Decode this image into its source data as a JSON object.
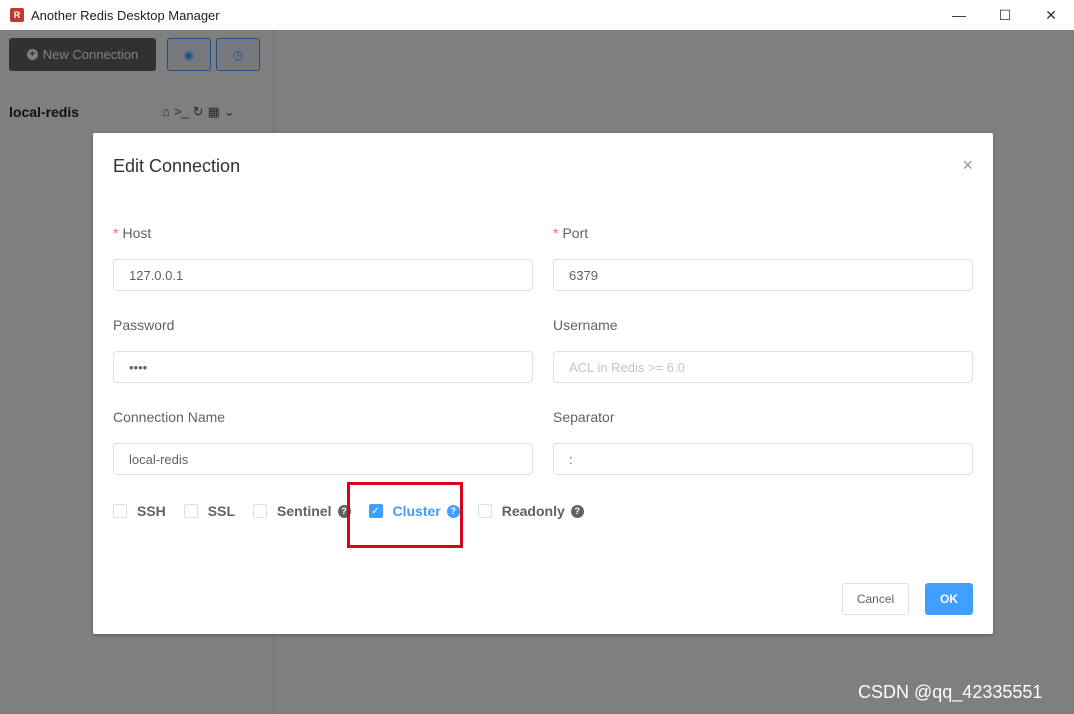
{
  "window": {
    "title": "Another Redis Desktop Manager",
    "icon": "app-logo-icon",
    "controls": {
      "minimize": "—",
      "maximize": "☐",
      "close": "✕"
    }
  },
  "sidebar": {
    "new_connection_label": "New Connection",
    "connection_name": "local-redis"
  },
  "dialog": {
    "title": "Edit Connection",
    "close_glyph": "×",
    "fields": {
      "host": {
        "label": "Host",
        "value": "127.0.0.1",
        "required": true
      },
      "port": {
        "label": "Port",
        "value": "6379",
        "required": true
      },
      "password": {
        "label": "Password",
        "value": "••••"
      },
      "username": {
        "label": "Username",
        "placeholder": "ACL in Redis >= 6.0"
      },
      "connection_name": {
        "label": "Connection Name",
        "value": "local-redis"
      },
      "separator": {
        "label": "Separator",
        "value": ":"
      }
    },
    "options": {
      "ssh": {
        "label": "SSH",
        "checked": false
      },
      "ssl": {
        "label": "SSL",
        "checked": false
      },
      "sentinel": {
        "label": "Sentinel",
        "checked": false
      },
      "cluster": {
        "label": "Cluster",
        "checked": true
      },
      "readonly": {
        "label": "Readonly",
        "checked": false
      }
    },
    "buttons": {
      "cancel": "Cancel",
      "ok": "OK"
    }
  },
  "watermark": "CSDN @qq_42335551",
  "colors": {
    "primary": "#409eff",
    "required": "#f56c6c",
    "highlight": "#d9001b"
  }
}
